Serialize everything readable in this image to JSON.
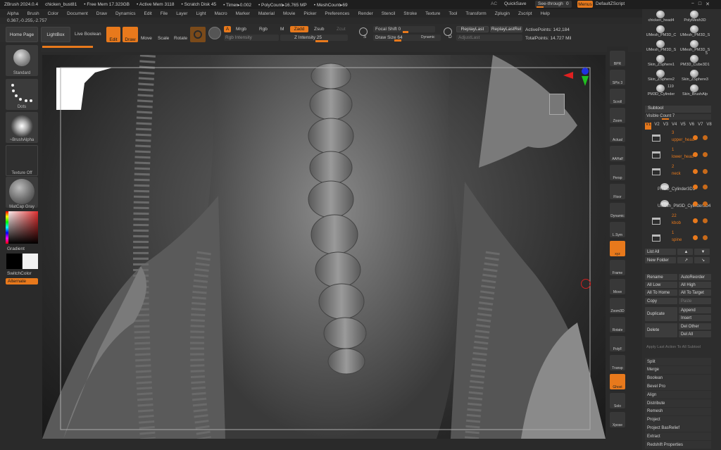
{
  "titlebar": {
    "app": "ZBrush 2024.0.4",
    "file": "chicken_bust81",
    "free_mem": "• Free Mem 17.323GB",
    "active_mem": "• Active Mem 3118",
    "scratch": "• Scratch Disk 45",
    "timer": "• Timer▸0.002",
    "polycount": "• PolyCount▸16.765 MP",
    "meshcount": "• MeshCount▸69",
    "ac": "AC",
    "quicksave": "QuickSave",
    "seethrough": "See-through",
    "seethrough_val": "0",
    "menus": "Menus",
    "defaultscript": "DefaultZScript"
  },
  "menubar": [
    "Alpha",
    "Brush",
    "Color",
    "Document",
    "Draw",
    "Dynamics",
    "Edit",
    "File",
    "Layer",
    "Light",
    "Macro",
    "Marker",
    "Material",
    "Movie",
    "Picker",
    "Preferences",
    "Render",
    "Stencil",
    "Stroke",
    "Texture",
    "Tool",
    "Transform",
    "Zplugin",
    "Zscript",
    "Help"
  ],
  "coords": "0.367,-0.255,-2.757",
  "shelf": {
    "home": "Home Page",
    "lightbox": "LightBox",
    "liveboolean": "Live Boolean",
    "edit": "Edit",
    "draw": "Draw",
    "move": "Move",
    "scale": "Scale",
    "rotate": "Rotate",
    "a": "A",
    "mrgb": "Mrgb",
    "rgb": "Rgb",
    "m": "M",
    "zadd": "Zadd",
    "zsub": "Zsub",
    "zcut": "Zcut",
    "rgb_intensity": "Rgb Intensity",
    "z_intensity": "Z Intensity 25",
    "focal_shift": "Focal Shift 0",
    "draw_size": "Draw Size 64",
    "dynamic": "Dynamic",
    "replaylast": "ReplayLast",
    "replaylastrel": "ReplayLastRel",
    "adjustlast": "AdjustLast",
    "active_points": "ActivePoints: 142,184",
    "total_points": "TotalPoints: 14.727 Mil",
    "s": "S",
    "d": "D"
  },
  "lefttools": [
    {
      "name": "Standard"
    },
    {
      "name": "Dots"
    },
    {
      "name": "~BrushAlpha"
    },
    {
      "name": "Texture Off"
    },
    {
      "name": "MatCap Gray"
    }
  ],
  "left": {
    "gradient": "Gradient",
    "switchcolor": "SwitchColor",
    "alternate": "Alternate"
  },
  "rightbar": [
    {
      "label": "BPR"
    },
    {
      "label": "SPix 3"
    },
    {
      "label": "Scroll"
    },
    {
      "label": "Zoom"
    },
    {
      "label": "Actual"
    },
    {
      "label": "AAHalf"
    },
    {
      "label": "Persp"
    },
    {
      "label": "Floor"
    },
    {
      "label": "Dynamic"
    },
    {
      "label": "L.Sym"
    },
    {
      "label": "xyz"
    },
    {
      "label": "Frame"
    },
    {
      "label": "Move"
    },
    {
      "label": "Zoom3D"
    },
    {
      "label": "Rotate"
    },
    {
      "label": "PolyF"
    },
    {
      "label": "Transp"
    },
    {
      "label": "Ghost"
    },
    {
      "label": "Solo"
    },
    {
      "label": "Xpose"
    }
  ],
  "brushes": [
    {
      "label": "chicken_head4"
    },
    {
      "label": "PolyMesh3D"
    },
    {
      "label": "UMesh_PM3D_C"
    },
    {
      "label": "UMesh_PM3D_S"
    },
    {
      "label": "UMesh_PM3D_S"
    },
    {
      "label": "UMesh_PM3D_S"
    },
    {
      "label": "Skin_ZSphere1"
    },
    {
      "label": "PM3D_Cube3D1"
    },
    {
      "label": "Skin_ZSphere2"
    },
    {
      "label": "Skin_ZSphere3"
    },
    {
      "label": "PM3D_Cylinder"
    },
    {
      "label": "Skin_BrushAlp"
    }
  ],
  "brushnums": {
    "n1": "5",
    "n2": "119"
  },
  "subtool": {
    "title": "Subtool",
    "visible_count": "Visible Count 7",
    "versions": [
      "V1",
      "V2",
      "V3",
      "V4",
      "V5",
      "V6",
      "V7",
      "V8"
    ],
    "items": [
      {
        "num": "3",
        "name": "upper_head"
      },
      {
        "num": "1",
        "name": "lower_head"
      },
      {
        "num": "2",
        "name": "neck"
      },
      {
        "num": "",
        "name": "PM3D_Cylinder3D1"
      },
      {
        "num": "",
        "name": "UMesh_PM3D_Cylinder3D4"
      },
      {
        "num": "22",
        "name": "kbob"
      },
      {
        "num": "1",
        "name": "spine"
      }
    ],
    "listall": "List All",
    "newfolder": "New Folder",
    "rename": "Rename",
    "autoreorder": "AutoReorder",
    "alllow": "All Low",
    "allhigh": "All High",
    "alltohome": "All To Home",
    "alltotarget": "All To Target",
    "copy": "Copy",
    "paste": "Paste",
    "duplicate": "Duplicate",
    "append": "Append",
    "insert": "Insert",
    "delete": "Delete",
    "delother": "Del Other",
    "delall": "Del All",
    "applylast": "Apply Last Action To All Subtool",
    "palettes": [
      "Split",
      "Merge",
      "Boolean",
      "Bevel Pro",
      "Align",
      "Distribute",
      "Remesh",
      "Project",
      "Project BasRelief",
      "Extract",
      "Redshift Properties"
    ]
  }
}
